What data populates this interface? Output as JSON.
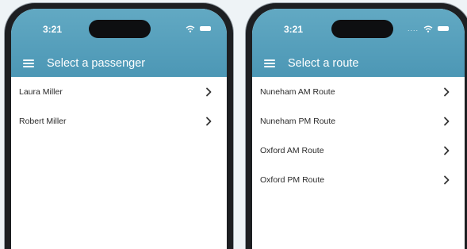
{
  "left_phone": {
    "status": {
      "time": "3:21"
    },
    "title": "Select a passenger",
    "items": [
      {
        "label": "Laura Miller"
      },
      {
        "label": "Robert Miller"
      }
    ]
  },
  "right_phone": {
    "status": {
      "time": "3:21",
      "dots": "...."
    },
    "title": "Select a route",
    "items": [
      {
        "label": "Nuneham AM Route"
      },
      {
        "label": "Nuneham PM Route"
      },
      {
        "label": "Oxford AM Route"
      },
      {
        "label": "Oxford PM Route"
      }
    ]
  },
  "colors": {
    "app_bar": "#56a0bd",
    "background": "#eef3f6",
    "phone_frame": "#1d1f22"
  },
  "icons": [
    "menu-icon",
    "chevron-right-icon",
    "wifi-icon",
    "battery-icon"
  ]
}
